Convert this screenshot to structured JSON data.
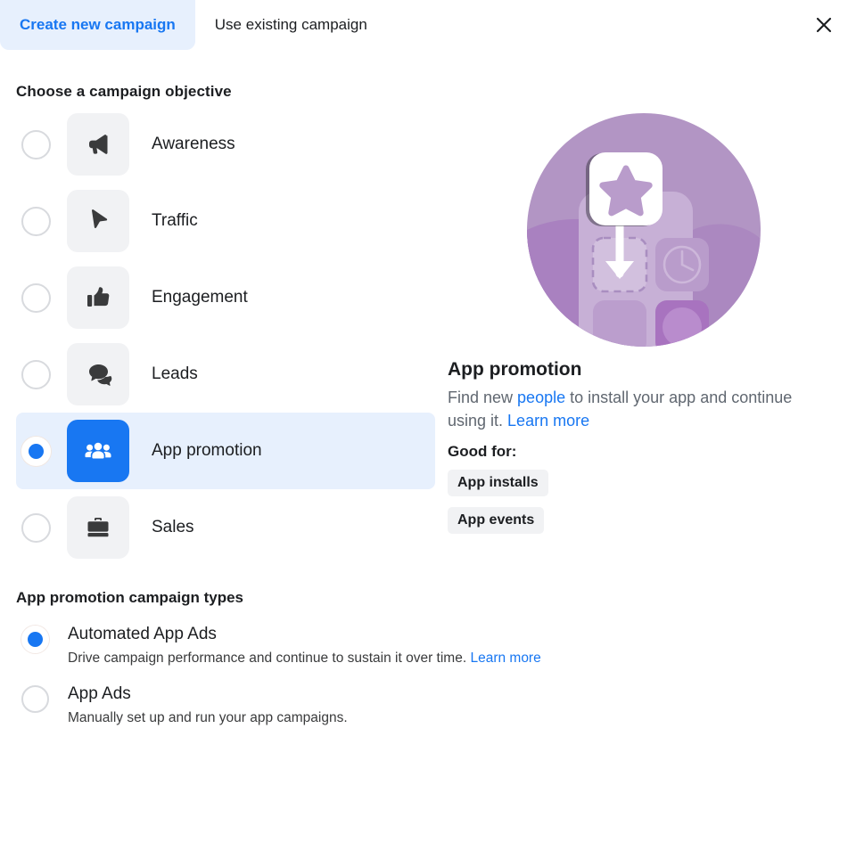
{
  "tabs": [
    {
      "label": "Create new campaign",
      "active": true
    },
    {
      "label": "Use existing campaign",
      "active": false
    }
  ],
  "close_icon": "close-icon",
  "objective_section": {
    "title": "Choose a campaign objective",
    "items": [
      {
        "label": "Awareness",
        "icon": "megaphone-icon",
        "selected": false
      },
      {
        "label": "Traffic",
        "icon": "cursor-icon",
        "selected": false
      },
      {
        "label": "Engagement",
        "icon": "thumbs-up-icon",
        "selected": false
      },
      {
        "label": "Leads",
        "icon": "chat-bubbles-icon",
        "selected": false
      },
      {
        "label": "App promotion",
        "icon": "people-group-icon",
        "selected": true
      },
      {
        "label": "Sales",
        "icon": "briefcase-icon",
        "selected": false
      }
    ]
  },
  "detail_panel": {
    "illustration": "app-promotion-illustration",
    "title": "App promotion",
    "desc_part1": "Find new ",
    "desc_link1": "people",
    "desc_part2": " to install your app and continue using it. ",
    "desc_link2": "Learn more",
    "good_for_label": "Good for:",
    "chips": [
      "App installs",
      "App events"
    ]
  },
  "campaign_types": {
    "title": "App promotion campaign types",
    "items": [
      {
        "name": "Automated App Ads",
        "desc": "Drive campaign performance and continue to sustain it over time. ",
        "link": "Learn more",
        "selected": true
      },
      {
        "name": "App Ads",
        "desc": "Manually set up and run your app campaigns.",
        "link": "",
        "selected": false
      }
    ]
  },
  "colors": {
    "accent": "#1877f2",
    "selected_row_bg": "#e7f0fd",
    "tile_bg": "#f1f2f4",
    "illustration_purple": "#b295c4"
  }
}
